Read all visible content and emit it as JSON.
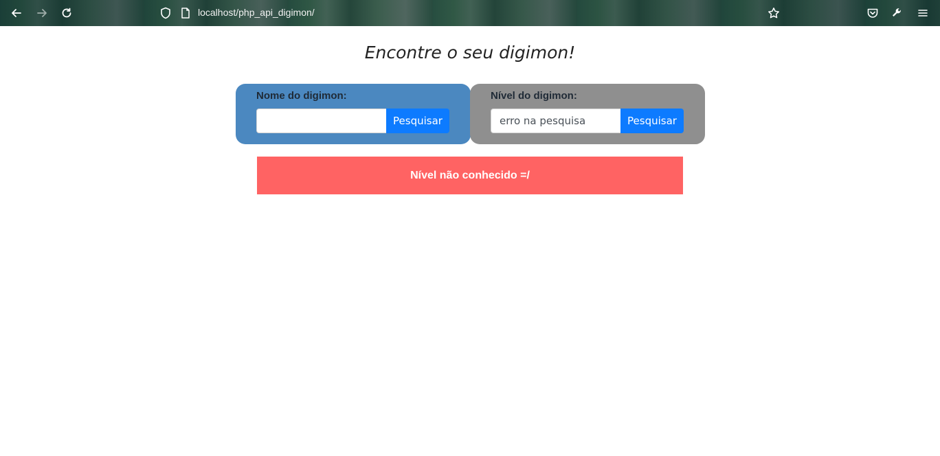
{
  "browser": {
    "url": "localhost/php_api_digimon/"
  },
  "page": {
    "title": "Encontre o seu digimon!"
  },
  "name_search": {
    "label": "Nome do digimon:",
    "input_value": "",
    "button_label": "Pesquisar",
    "panel_color": "#4b88c0"
  },
  "level_search": {
    "label": "Nível do digimon:",
    "input_value": "erro na pesquisa",
    "button_label": "Pesquisar",
    "panel_color": "#8f8f8f"
  },
  "alert": {
    "message": "Nível não conhecido =/",
    "color": "#ff6363"
  },
  "colors": {
    "button": "#0d7bff"
  }
}
